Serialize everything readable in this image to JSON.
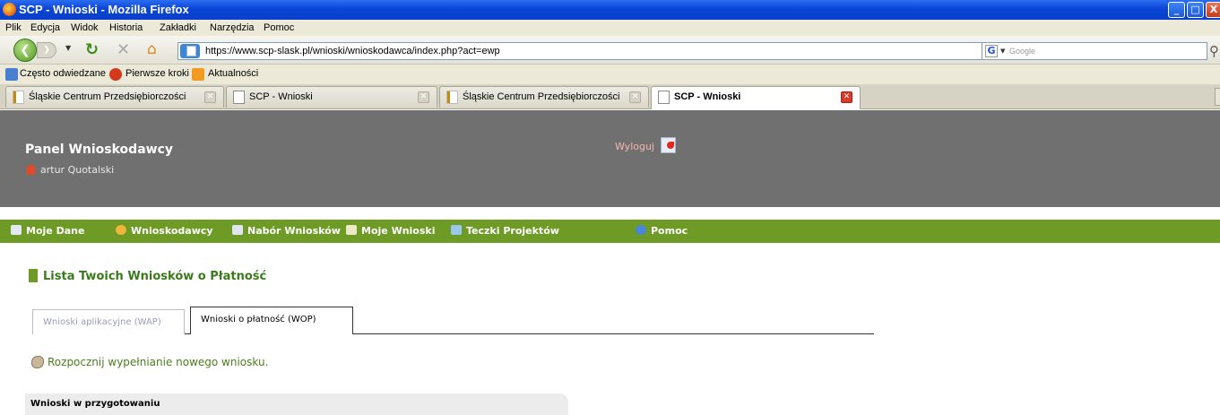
{
  "window": {
    "title": "SCP - Wnioski - Mozilla Firefox",
    "controls": {
      "minimize": "_",
      "maximize": "□",
      "close": "X"
    }
  },
  "menu": {
    "items": [
      "Plik",
      "Edycja",
      "Widok",
      "Historia",
      "Zakładki",
      "Narzędzia",
      "Pomoc"
    ]
  },
  "nav": {
    "url": "https://www.scp-slask.pl/wnioski/wnioskodawca/index.php?act=ewp",
    "search_placeholder": "Google",
    "search_engine": "G"
  },
  "bookmarks": {
    "items": [
      "Często odwiedzane",
      "Pierwsze kroki",
      "Aktualności"
    ]
  },
  "tabs": [
    {
      "label": "Śląskie Centrum Przedsiębiorczości",
      "active": false
    },
    {
      "label": "SCP - Wnioski",
      "active": false
    },
    {
      "label": "Śląskie Centrum Przedsiębiorczości",
      "active": false
    },
    {
      "label": "SCP - Wnioski",
      "active": true
    }
  ],
  "app": {
    "panel_title": "Panel Wnioskodawcy",
    "user_name": "artur Quotalski",
    "logout_label": "Wyloguj"
  },
  "main_nav": {
    "items": [
      "Moje Dane",
      "Wnioskodawcy",
      "Nabór Wniosków",
      "Moje Wnioski",
      "Teczki Projektów",
      "Pomoc"
    ],
    "accent": "#6d9b25"
  },
  "content": {
    "section_title": "Lista Twoich Wniosków o Płatność",
    "subtabs": [
      "Wnioski aplikacyjne (WAP)",
      "Wnioski o płatność (WOP)"
    ],
    "new_application_link": "Rozpocznij wypełnianie nowego wniosku.",
    "prep_header": "Wnioski w przygotowaniu"
  }
}
